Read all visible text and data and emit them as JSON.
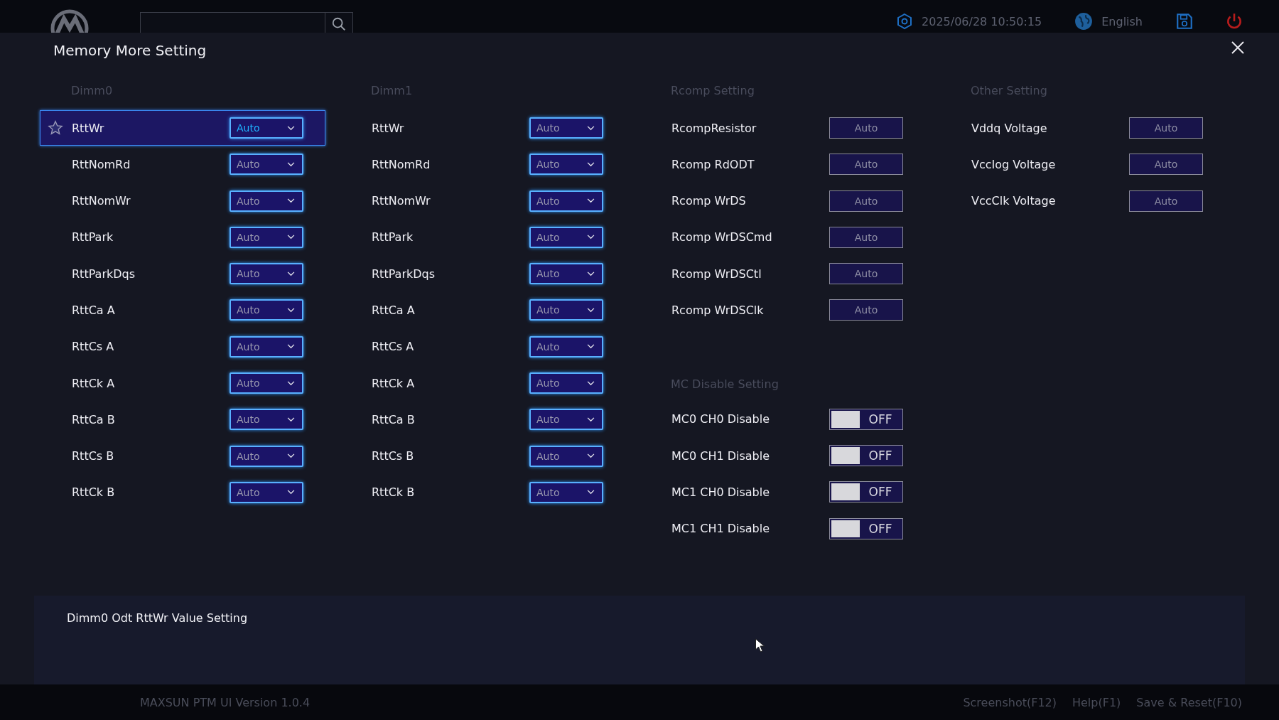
{
  "top_bar": {
    "datetime": "2025/06/28 10:50:15",
    "language": "English"
  },
  "dialog": {
    "title": "Memory More Setting"
  },
  "columns": [
    {
      "sections": [
        {
          "title": "Dimm0",
          "items": [
            {
              "label": "RttWr",
              "kind": "dropdown",
              "value": "Auto",
              "selected": true
            },
            {
              "label": "RttNomRd",
              "kind": "dropdown",
              "value": "Auto",
              "selected": false
            },
            {
              "label": "RttNomWr",
              "kind": "dropdown",
              "value": "Auto",
              "selected": false
            },
            {
              "label": "RttPark",
              "kind": "dropdown",
              "value": "Auto",
              "selected": false
            },
            {
              "label": "RttParkDqs",
              "kind": "dropdown",
              "value": "Auto",
              "selected": false
            },
            {
              "label": "RttCa A",
              "kind": "dropdown",
              "value": "Auto",
              "selected": false
            },
            {
              "label": "RttCs A",
              "kind": "dropdown",
              "value": "Auto",
              "selected": false
            },
            {
              "label": "RttCk A",
              "kind": "dropdown",
              "value": "Auto",
              "selected": false
            },
            {
              "label": "RttCa B",
              "kind": "dropdown",
              "value": "Auto",
              "selected": false
            },
            {
              "label": "RttCs B",
              "kind": "dropdown",
              "value": "Auto",
              "selected": false
            },
            {
              "label": "RttCk B",
              "kind": "dropdown",
              "value": "Auto",
              "selected": false
            }
          ]
        }
      ]
    },
    {
      "sections": [
        {
          "title": "Dimm1",
          "items": [
            {
              "label": "RttWr",
              "kind": "dropdown",
              "value": "Auto",
              "selected": false
            },
            {
              "label": "RttNomRd",
              "kind": "dropdown",
              "value": "Auto",
              "selected": false
            },
            {
              "label": "RttNomWr",
              "kind": "dropdown",
              "value": "Auto",
              "selected": false
            },
            {
              "label": "RttPark",
              "kind": "dropdown",
              "value": "Auto",
              "selected": false
            },
            {
              "label": "RttParkDqs",
              "kind": "dropdown",
              "value": "Auto",
              "selected": false
            },
            {
              "label": "RttCa A",
              "kind": "dropdown",
              "value": "Auto",
              "selected": false
            },
            {
              "label": "RttCs A",
              "kind": "dropdown",
              "value": "Auto",
              "selected": false
            },
            {
              "label": "RttCk A",
              "kind": "dropdown",
              "value": "Auto",
              "selected": false
            },
            {
              "label": "RttCa B",
              "kind": "dropdown",
              "value": "Auto",
              "selected": false
            },
            {
              "label": "RttCs B",
              "kind": "dropdown",
              "value": "Auto",
              "selected": false
            },
            {
              "label": "RttCk B",
              "kind": "dropdown",
              "value": "Auto",
              "selected": false
            }
          ]
        }
      ]
    },
    {
      "sections": [
        {
          "title": "Rcomp Setting",
          "items": [
            {
              "label": "RcompResistor",
              "kind": "button",
              "value": "Auto",
              "selected": false
            },
            {
              "label": "Rcomp RdODT",
              "kind": "button",
              "value": "Auto",
              "selected": false
            },
            {
              "label": "Rcomp WrDS",
              "kind": "button",
              "value": "Auto",
              "selected": false
            },
            {
              "label": "Rcomp WrDSCmd",
              "kind": "button",
              "value": "Auto",
              "selected": false
            },
            {
              "label": "Rcomp WrDSCtl",
              "kind": "button",
              "value": "Auto",
              "selected": false
            },
            {
              "label": "Rcomp WrDSClk",
              "kind": "button",
              "value": "Auto",
              "selected": false
            }
          ]
        },
        {
          "title": "MC Disable Setting",
          "items": [
            {
              "label": "MC0 CH0 Disable",
              "kind": "toggle",
              "value": "OFF",
              "on": false,
              "selected": false
            },
            {
              "label": "MC0 CH1 Disable",
              "kind": "toggle",
              "value": "OFF",
              "on": false,
              "selected": false
            },
            {
              "label": "MC1 CH0 Disable",
              "kind": "toggle",
              "value": "OFF",
              "on": false,
              "selected": false
            },
            {
              "label": "MC1 CH1 Disable",
              "kind": "toggle",
              "value": "OFF",
              "on": false,
              "selected": false
            }
          ]
        }
      ]
    },
    {
      "sections": [
        {
          "title": "Other Setting",
          "items": [
            {
              "label": "Vddq Voltage",
              "kind": "button",
              "value": "Auto",
              "selected": false
            },
            {
              "label": "VccIog Voltage",
              "kind": "button",
              "value": "Auto",
              "selected": false
            },
            {
              "label": "VccClk Voltage",
              "kind": "button",
              "value": "Auto",
              "selected": false
            }
          ]
        }
      ]
    }
  ],
  "description": "Dimm0 Odt RttWr Value Setting",
  "footer": {
    "version": "MAXSUN PTM UI Version 1.0.4",
    "actions": [
      "Screenshot(F12)",
      "Help(F1)",
      "Save & Reset(F10)"
    ]
  }
}
